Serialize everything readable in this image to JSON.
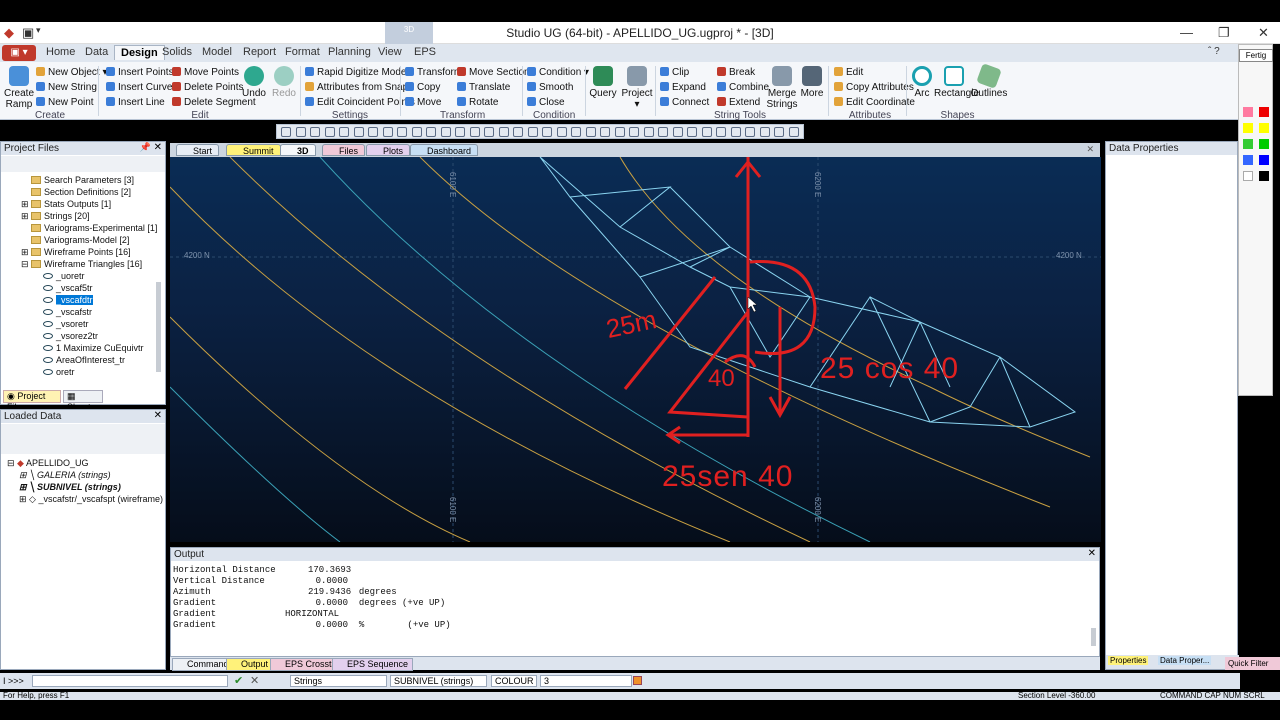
{
  "window": {
    "title": "Studio UG (64-bit) - APELLIDO_UG.ugproj * - [3D]",
    "floating_tab": "3D"
  },
  "ribbon_tabs": [
    "Home",
    "Data",
    "Design",
    "Solids",
    "Model",
    "Report",
    "Format",
    "Planning",
    "View",
    "EPS"
  ],
  "active_tab": "Design",
  "ribbon": {
    "create": {
      "big": "Create Ramp",
      "items": [
        "New Object",
        "New String",
        "New Point"
      ],
      "label": "Create"
    },
    "edit": {
      "items": [
        "Insert Points",
        "Insert Curve",
        "Insert Line",
        "Move Points",
        "Delete Points",
        "Delete Segment"
      ],
      "undo": "Undo",
      "redo": "Redo",
      "label": "Edit"
    },
    "settings": {
      "items": [
        "Rapid Digitize Mode",
        "Attributes from Snap",
        "Edit Coincident Points"
      ],
      "label": "Settings"
    },
    "transform": {
      "items": [
        "Transform",
        "Copy",
        "Move",
        "Move Section",
        "Translate",
        "Rotate"
      ],
      "label": "Transform"
    },
    "condition": {
      "items": [
        "Condition",
        "Smooth",
        "Close"
      ],
      "label": "Condition"
    },
    "query": "Query",
    "project": "Project",
    "string_tools": {
      "items": [
        "Clip",
        "Expand",
        "Connect",
        "Break",
        "Combine",
        "Extend"
      ],
      "merge": "Merge Strings",
      "more": "More",
      "label": "String Tools"
    },
    "attributes": {
      "items": [
        "Edit",
        "Copy Attributes",
        "Edit Coordinate"
      ],
      "label": "Attributes"
    },
    "shapes": {
      "items": [
        "Arc",
        "Rectangle",
        "Outlines"
      ],
      "label": "Shapes"
    }
  },
  "project_files": {
    "title": "Project Files",
    "items": [
      "Search Parameters [3]",
      "Section Definitions [2]",
      "Stats Outputs [1]",
      "Strings [20]",
      "Variograms-Experimental [1]",
      "Variograms-Model [2]",
      "Wireframe Points [16]",
      "Wireframe Triangles [16]"
    ],
    "children": [
      "_uoretr",
      "_vscaf5tr",
      "_vscafdtr",
      "_vscafstr",
      "_vsoretr",
      "_vsorez2tr",
      "1 Maximize CuEquivtr",
      "AreaOfInterest_tr",
      "oretr"
    ],
    "selected": "_vscafdtr",
    "tabs": [
      "Project Files",
      "Sheets"
    ]
  },
  "loaded_data": {
    "title": "Loaded Data",
    "root": "APELLIDO_UG",
    "items": [
      "GALERIA (strings)",
      "SUBNIVEL (strings)",
      "_vscafstr/_vscafspt (wireframe)"
    ]
  },
  "view_tabs": [
    "Start",
    "Summit",
    "3D",
    "Files",
    "Plots",
    "Dashboard"
  ],
  "viewport": {
    "grid": [
      "6100 E",
      "6200 E",
      "4200 N",
      "4200 N",
      "6100 E",
      "6200 E"
    ],
    "annotations": [
      "25m",
      "40",
      "25 cos 40",
      "25sen 40"
    ]
  },
  "output": {
    "title": "Output",
    "lines": [
      [
        "Horizontal Distance",
        "170.3693",
        ""
      ],
      [
        "Vertical Distance",
        "0.0000",
        ""
      ],
      [
        "Azimuth",
        "219.9436",
        "degrees"
      ],
      [
        "Gradient",
        "0.0000",
        "degrees (+ve UP)"
      ],
      [
        "Gradient",
        "HORIZONTAL",
        ""
      ],
      [
        "Gradient",
        "0.0000",
        "%        (+ve UP)"
      ]
    ]
  },
  "bottom_tabs": [
    "Command",
    "Output",
    "EPS Crosstab",
    "EPS Sequence"
  ],
  "right_tabs": [
    "Properties",
    "Data Proper...",
    "Quick Filter"
  ],
  "data_properties": {
    "title": "Data Properties"
  },
  "cmdbar": {
    "prompt": "I >>>",
    "type": "Strings",
    "object": "SUBNIVEL (strings)",
    "attr": "COLOUR",
    "value": "3"
  },
  "status": {
    "left": "For Help, press F1",
    "mid": "Section Level -360.00",
    "right": "COMMAND CAP NUM SCRL READ"
  },
  "fertig": "Fertig"
}
